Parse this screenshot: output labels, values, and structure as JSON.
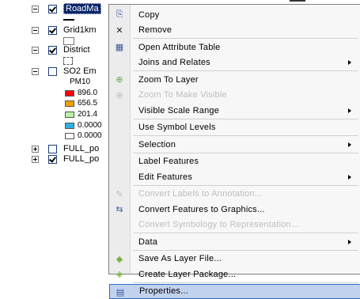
{
  "toc": {
    "layers": [
      {
        "label": "RoadMa",
        "checked": true,
        "selected": true,
        "expanded": true
      },
      {
        "label": "Grid1km",
        "checked": true,
        "selected": false,
        "expanded": true
      },
      {
        "label": "District",
        "checked": true,
        "selected": false,
        "expanded": true
      },
      {
        "label": "SO2 Em",
        "checked": false,
        "selected": false,
        "expanded": true
      },
      {
        "label": "FULL_po",
        "checked": false,
        "selected": false,
        "expanded": false
      },
      {
        "label": "FULL_po",
        "checked": true,
        "selected": false,
        "expanded": false
      }
    ],
    "so2_field": "PM10",
    "legend": [
      {
        "value": "896.0",
        "color": "#ff0000"
      },
      {
        "value": "656.5",
        "color": "#f0a000"
      },
      {
        "value": "201.4",
        "color": "#b8f0a8"
      },
      {
        "value": "0.0000",
        "color": "#30b0e0"
      },
      {
        "value": "0.0000",
        "color": "#ffffff"
      }
    ]
  },
  "menu": {
    "items": [
      {
        "label": "Copy",
        "icon": "copy-icon",
        "glyph": "⎘",
        "submenu": false,
        "disabled": false
      },
      {
        "label": "Remove",
        "icon": "remove-icon",
        "glyph": "✕",
        "submenu": false,
        "disabled": false
      },
      {
        "sep": true
      },
      {
        "label": "Open Attribute Table",
        "icon": "table-icon",
        "glyph": "▦",
        "submenu": false,
        "disabled": false
      },
      {
        "label": "Joins and Relates",
        "icon": "",
        "glyph": "",
        "submenu": true,
        "disabled": false
      },
      {
        "sep": true
      },
      {
        "label": "Zoom To Layer",
        "icon": "zoom-to-layer-icon",
        "glyph": "⊕",
        "submenu": false,
        "disabled": false
      },
      {
        "label": "Zoom To Make Visible",
        "icon": "zoom-visible-icon",
        "glyph": "⊕",
        "submenu": false,
        "disabled": true
      },
      {
        "label": "Visible Scale Range",
        "icon": "",
        "glyph": "",
        "submenu": true,
        "disabled": false
      },
      {
        "sep": true
      },
      {
        "label": "Use Symbol Levels",
        "icon": "",
        "glyph": "",
        "submenu": false,
        "disabled": false
      },
      {
        "sep": true
      },
      {
        "label": "Selection",
        "icon": "",
        "glyph": "",
        "submenu": true,
        "disabled": false
      },
      {
        "sep": true
      },
      {
        "label": "Label Features",
        "icon": "",
        "glyph": "",
        "submenu": false,
        "disabled": false
      },
      {
        "label": "Edit Features",
        "icon": "",
        "glyph": "",
        "submenu": true,
        "disabled": false
      },
      {
        "sep": true
      },
      {
        "label": "Convert Labels to Annotation...",
        "icon": "convert-labels-icon",
        "glyph": "✎",
        "submenu": false,
        "disabled": true
      },
      {
        "label": "Convert Features to Graphics...",
        "icon": "convert-graphics-icon",
        "glyph": "⇆",
        "submenu": false,
        "disabled": false
      },
      {
        "label": "Convert Symbology to Representation...",
        "icon": "",
        "glyph": "",
        "submenu": false,
        "disabled": true
      },
      {
        "sep": true
      },
      {
        "label": "Data",
        "icon": "",
        "glyph": "",
        "submenu": true,
        "disabled": false
      },
      {
        "sep": true
      },
      {
        "label": "Save As Layer File...",
        "icon": "save-layer-icon",
        "glyph": "◆",
        "submenu": false,
        "disabled": false
      },
      {
        "label": "Create Layer Package...",
        "icon": "layer-package-icon",
        "glyph": "◈",
        "submenu": false,
        "disabled": false
      },
      {
        "sep": true
      },
      {
        "label": "Properties...",
        "icon": "properties-icon",
        "glyph": "▤",
        "submenu": false,
        "disabled": false,
        "highlighted": true
      }
    ]
  },
  "colors": {
    "selection": "#0a246a",
    "menu_highlight": "#c1d2ee",
    "menu_highlight_border": "#316ac5"
  }
}
